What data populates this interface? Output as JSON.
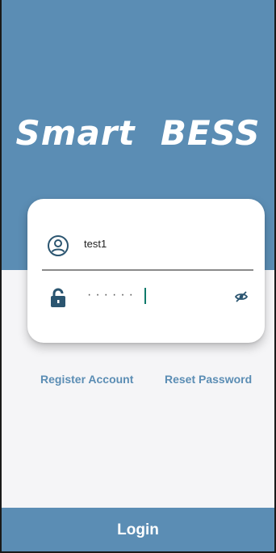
{
  "app": {
    "title": "Smart  BESS"
  },
  "login_form": {
    "username": {
      "value": "test1",
      "icon": "user-circle-icon"
    },
    "password": {
      "masked_value": "······",
      "lock_icon": "lock-icon",
      "toggle_icon": "eye-off-icon"
    }
  },
  "links": {
    "register": "Register Account",
    "reset": "Reset Password"
  },
  "footer": {
    "login_label": "Login"
  },
  "colors": {
    "primary": "#5b8db4",
    "background": "#f5f5f7",
    "card": "#ffffff",
    "caret": "#0f7a6b"
  }
}
